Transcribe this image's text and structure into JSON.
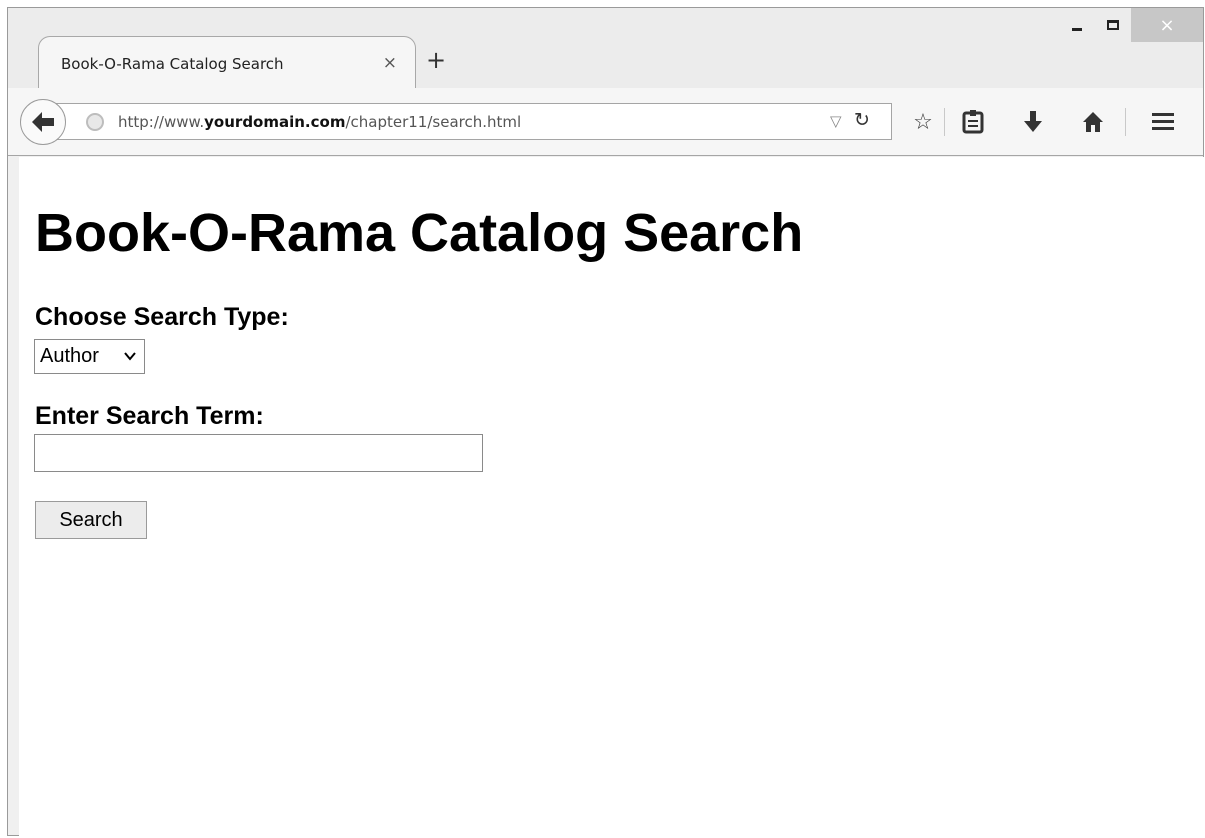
{
  "browser": {
    "tab_title": "Book-O-Rama Catalog Search",
    "tab_close": "×",
    "new_tab": "+",
    "url_prefix": "http://www.",
    "url_domain": "yourdomain.com",
    "url_path": "/chapter11/search.html",
    "icons": [
      "back-arrow-icon",
      "globe-icon",
      "dropmarker-icon",
      "reload-icon",
      "bookmark-star-icon",
      "reading-list-icon",
      "download-icon",
      "home-icon",
      "menu-icon"
    ]
  },
  "window_controls": {
    "close": "×"
  },
  "page": {
    "title": "Book-O-Rama Catalog Search",
    "search_type_label": "Choose Search Type:",
    "search_type_selected": "Author",
    "search_term_label": "Enter Search Term:",
    "search_term_value": "",
    "search_button": "Search"
  }
}
